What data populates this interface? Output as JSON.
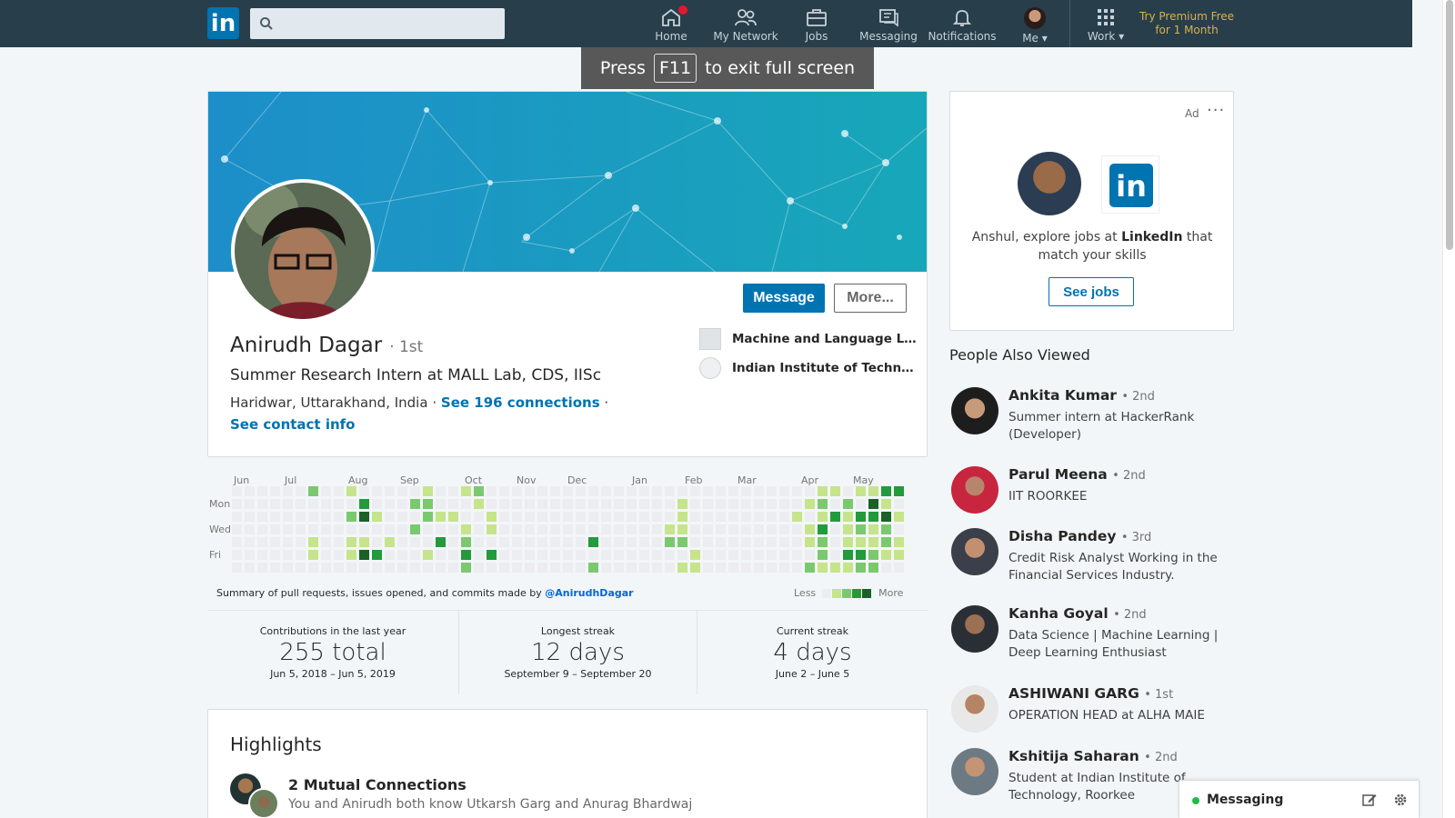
{
  "header": {
    "logo_text": "in",
    "search_placeholder": "",
    "nav": [
      {
        "label": "Home",
        "icon": "home-icon"
      },
      {
        "label": "My Network",
        "icon": "network-icon"
      },
      {
        "label": "Jobs",
        "icon": "briefcase-icon"
      },
      {
        "label": "Messaging",
        "icon": "messaging-icon"
      },
      {
        "label": "Notifications",
        "icon": "bell-icon"
      },
      {
        "label": "Me ▾",
        "icon": "avatar"
      },
      {
        "label": "Work ▾",
        "icon": "grid-icon"
      }
    ],
    "premium_line1": "Try Premium Free",
    "premium_line2": "for 1 Month"
  },
  "fullscreen_toast": {
    "before": "Press",
    "key": "F11",
    "after": "to exit full screen"
  },
  "profile": {
    "name": "Anirudh Dagar",
    "degree": "· 1st",
    "headline": "Summer Research Intern at MALL Lab, CDS, IISc",
    "location": "Haridwar, Uttarakhand, India",
    "connections_link": "See 196 connections",
    "dot": "·",
    "contact_link": "See contact info",
    "message_button": "Message",
    "more_button": "More...",
    "orgs": [
      "Machine and Language Le...",
      "Indian Institute of Technol..."
    ]
  },
  "contributions": {
    "months": [
      "Jun",
      "Jul",
      "Aug",
      "Sep",
      "Oct",
      "Nov",
      "Dec",
      "Jan",
      "Feb",
      "Mar",
      "Apr",
      "May"
    ],
    "days": [
      "Mon",
      "Wed",
      "Fri"
    ],
    "summary_prefix": "Summary of pull requests, issues opened, and commits made by",
    "summary_user": "@AnirudhDagar",
    "legend_less": "Less",
    "legend_more": "More",
    "colors": [
      "#ebedf0",
      "#c6e48b",
      "#7bc96f",
      "#239a3b",
      "#196127"
    ],
    "stats": [
      {
        "title": "Contributions in the last year",
        "value": "255 total",
        "dates": "Jun 5, 2018 – Jun 5, 2019"
      },
      {
        "title": "Longest streak",
        "value": "12 days",
        "dates": "September 9 – September 20"
      },
      {
        "title": "Current streak",
        "value": "4 days",
        "dates": "June 2 – June 5"
      }
    ]
  },
  "highlights": {
    "title": "Highlights",
    "item_title": "2 Mutual Connections",
    "item_sub": "You and Anirudh both know Utkarsh Garg and Anurag Bhardwaj"
  },
  "ad": {
    "label": "Ad",
    "menu": "···",
    "text_prefix": "Anshul, explore jobs at",
    "text_brand": "LinkedIn",
    "text_suffix": "that match your skills",
    "button": "See jobs"
  },
  "people_also_viewed": {
    "title": "People Also Viewed",
    "people": [
      {
        "name": "Ankita Kumar",
        "degree": "• 2nd",
        "headline": "Summer intern at HackerRank (Developer)"
      },
      {
        "name": "Parul Meena",
        "degree": "• 2nd",
        "headline": "IIT ROORKEE"
      },
      {
        "name": "Disha Pandey",
        "degree": "• 3rd",
        "headline": "Credit Risk Analyst Working in the Financial Services Industry."
      },
      {
        "name": "Kanha Goyal",
        "degree": "• 2nd",
        "headline": "Data Science | Machine Learning | Deep Learning Enthusiast"
      },
      {
        "name": "ASHIWANI GARG",
        "degree": "• 1st",
        "headline": "OPERATION HEAD at ALHA MAIE"
      },
      {
        "name": "Kshitija Saharan",
        "degree": "• 2nd",
        "headline": "Student at Indian Institute of Technology, Roorkee"
      }
    ]
  },
  "messaging": {
    "label": "Messaging"
  }
}
